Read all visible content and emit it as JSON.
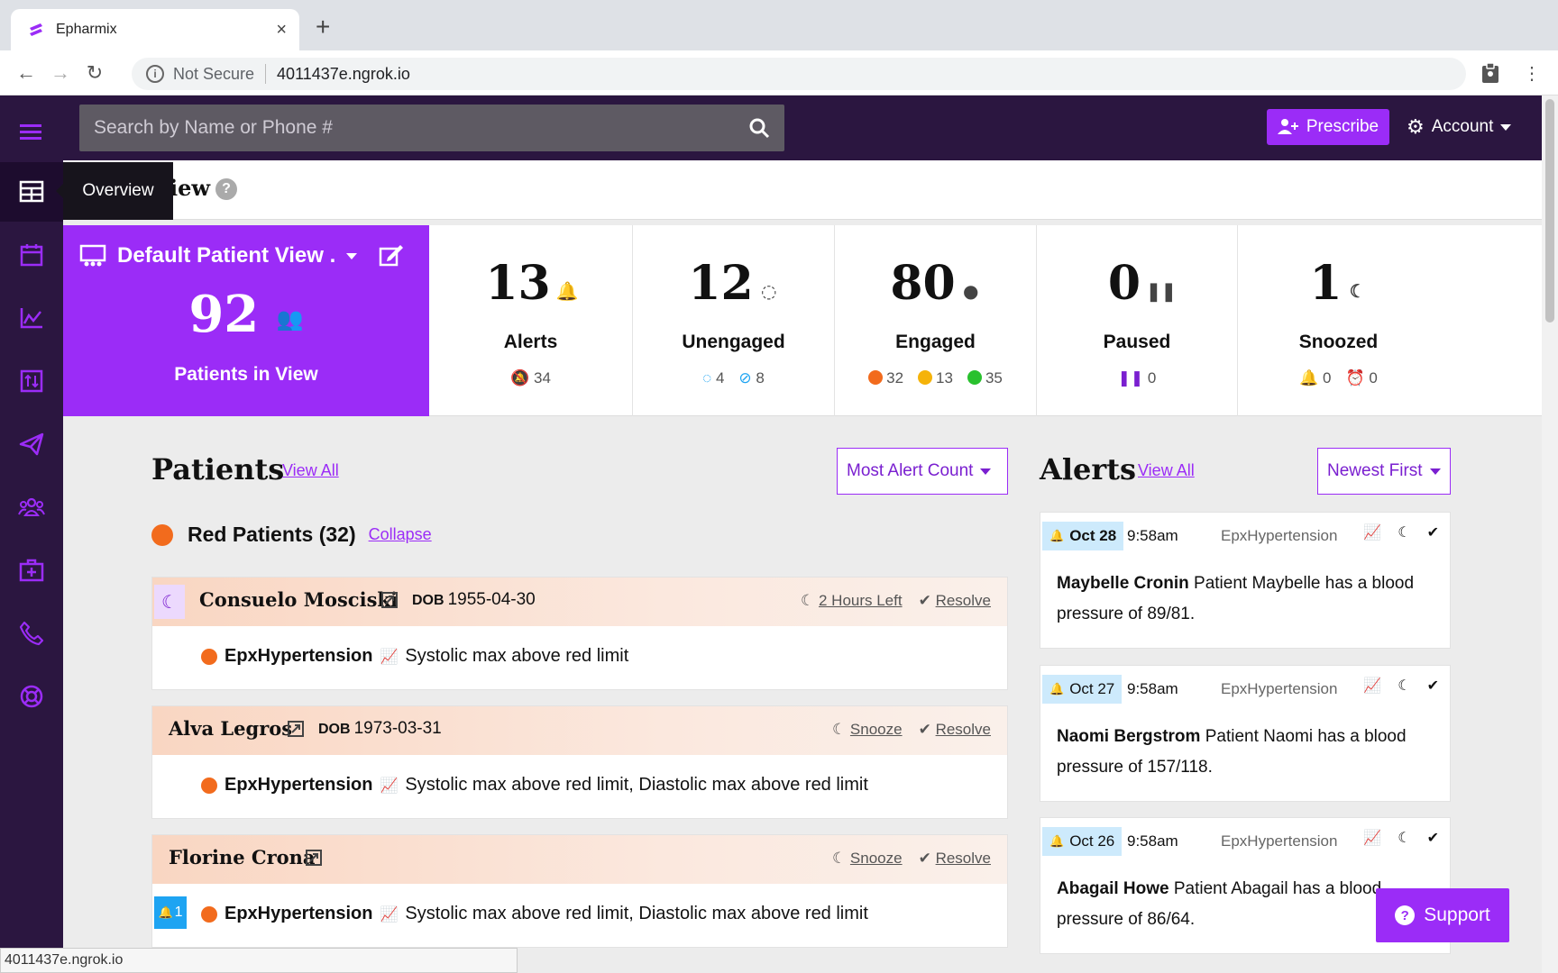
{
  "browser": {
    "tab_title": "Epharmix",
    "omnibox_security": "Not Secure",
    "url": "4011437e.ngrok.io",
    "status_url": "4011437e.ngrok.io"
  },
  "topbar": {
    "search_placeholder": "Search by Name or Phone #",
    "prescribe_label": "Prescribe",
    "account_label": "Account"
  },
  "sidebar": {
    "tooltip": "Overview",
    "items": [
      "menu-icon",
      "overview-icon",
      "calendar-icon",
      "chart-icon",
      "transfer-icon",
      "send-icon",
      "users-icon",
      "medkit-icon",
      "phone-icon",
      "lifering-icon"
    ]
  },
  "page": {
    "title_visible": "iew"
  },
  "view_card": {
    "name": "Default Patient View .",
    "count": "92",
    "label": "Patients in View"
  },
  "stats": [
    {
      "value": "13",
      "label": "Alerts",
      "sub": [
        "34"
      ]
    },
    {
      "value": "12",
      "label": "Unengaged",
      "sub": [
        "4",
        "8"
      ]
    },
    {
      "value": "80",
      "label": "Engaged",
      "sub": [
        "32",
        "13",
        "35"
      ]
    },
    {
      "value": "0",
      "label": "Paused",
      "sub": [
        "0"
      ]
    },
    {
      "value": "1",
      "label": "Snoozed",
      "sub": [
        "0",
        "0"
      ]
    }
  ],
  "colors": {
    "accent": "#9b2cf7",
    "red": "#f26b1d",
    "yellow": "#f5b30a",
    "green": "#29c12e",
    "alert_blue": "#1ea4f2"
  },
  "patients": {
    "title": "Patients",
    "view_all": "View All",
    "sort": "Most Alert Count",
    "group": {
      "label": "Red Patients (32)",
      "collapse": "Collapse"
    },
    "list": [
      {
        "name": "Consuelo Mosciski",
        "dob_label": "DOB",
        "dob": "1955-04-30",
        "snooze": "2 Hours Left",
        "resolve": "Resolve",
        "program": "EpxHypertension",
        "reason": "Systolic max above red limit"
      },
      {
        "name": "Alva Legros",
        "dob_label": "DOB",
        "dob": "1973-03-31",
        "snooze": "Snooze",
        "resolve": "Resolve",
        "program": "EpxHypertension",
        "reason": "Systolic max above red limit, Diastolic max above red limit"
      },
      {
        "name": "Florine Crona",
        "snooze": "Snooze",
        "resolve": "Resolve",
        "alert_count": "1",
        "program": "EpxHypertension",
        "reason": "Systolic max above red limit, Diastolic max above red limit"
      }
    ]
  },
  "alerts": {
    "title": "Alerts",
    "view_all": "View All",
    "sort": "Newest First",
    "list": [
      {
        "date": "Oct 28",
        "time": "9:58am",
        "program": "EpxHypertension",
        "name": "Maybelle Cronin",
        "text": "Patient Maybelle has a blood pressure of 89/81."
      },
      {
        "date": "Oct 27",
        "time": "9:58am",
        "program": "EpxHypertension",
        "name": "Naomi Bergstrom",
        "text": "Patient Naomi has a blood pressure of 157/118."
      },
      {
        "date": "Oct 26",
        "time": "9:58am",
        "program": "EpxHypertension",
        "name": "Abagail Howe",
        "text": "Patient Abagail has a blood pressure of 86/64."
      }
    ]
  },
  "support_label": "Support"
}
